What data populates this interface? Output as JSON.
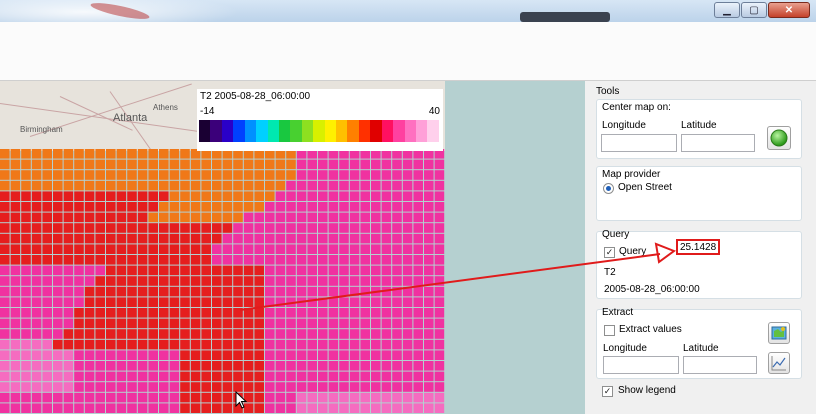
{
  "map": {
    "cities": [
      "Athens",
      "Atlanta",
      "Birmingham"
    ],
    "legend": {
      "title": "T2 2005-08-28_06:00:00",
      "min": "-14",
      "max": "40",
      "colors": [
        "#1a0033",
        "#3b007a",
        "#2a00c8",
        "#0040ff",
        "#0090ff",
        "#00d0ff",
        "#00e8b0",
        "#19c840",
        "#48d030",
        "#8ee020",
        "#d8f000",
        "#fff000",
        "#ffc000",
        "#ff8000",
        "#ff3000",
        "#e00000",
        "#ff1060",
        "#ff40a0",
        "#ff70c0",
        "#ffa0d8",
        "#ffd0ec"
      ]
    }
  },
  "panel": {
    "tools_title": "Tools",
    "center": {
      "title": "Center map on:",
      "longitude_label": "Longitude",
      "latitude_label": "Latitude",
      "go_icon": "green-circle-icon"
    },
    "provider": {
      "title": "Map provider",
      "option": "Open Street"
    },
    "query": {
      "title": "Query",
      "checkbox_label": "Query",
      "checked": true,
      "value": "25.1428",
      "variable": "T2",
      "time": "2005-08-28_06:00:00"
    },
    "extract": {
      "title": "Extract",
      "checkbox_label": "Extract values",
      "longitude_label": "Longitude",
      "latitude_label": "Latitude",
      "extract_icon": "extract-map-icon",
      "chart_icon": "chart-icon"
    },
    "show_legend": {
      "label": "Show legend",
      "checked": true
    }
  },
  "colors": {
    "annotation_red": "#e01b1b",
    "orange": "#f07818",
    "red": "#e51e1e",
    "pink": "#f032a0",
    "light_pink": "#f56cc0"
  }
}
